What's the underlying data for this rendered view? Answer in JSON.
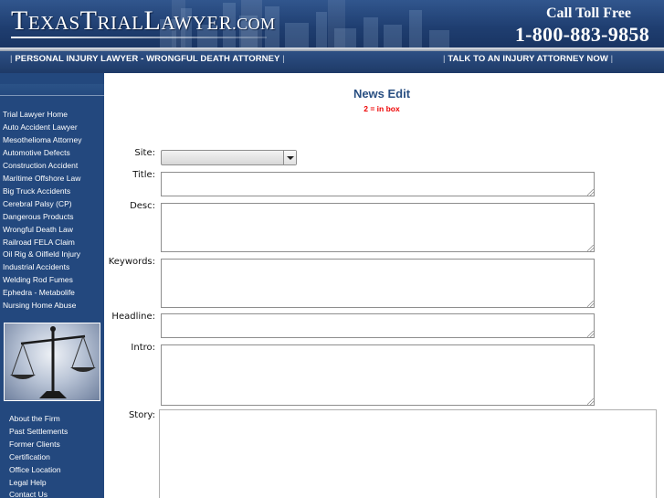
{
  "header": {
    "logo_text": "TexasTrialLawyer.com",
    "logo_parts": [
      "T",
      "EXAS",
      "T",
      "RIAL",
      "L",
      "AWYER",
      ".COM"
    ],
    "call_label": "Call Toll Free",
    "phone": "1-800-883-9858"
  },
  "nav": {
    "left": "PERSONAL INJURY LAWYER - WRONGFUL DEATH ATTORNEY",
    "right": "TALK TO AN INJURY ATTORNEY NOW",
    "separator": "|"
  },
  "sidebar": {
    "practice_links": [
      "Trial Lawyer Home",
      "Auto Accident Lawyer",
      "Mesothelioma Attorney",
      "Automotive Defects",
      "Construction Accident",
      "Maritime Offshore Law",
      "Big Truck Accidents",
      "Cerebral Palsy (CP)",
      "Dangerous Products",
      "Wrongful Death Law",
      "Railroad FELA Claim",
      "Oil Rig & Oilfield Injury",
      "Industrial Accidents",
      "Welding Rod Fumes",
      "Ephedra - Metabolife",
      "Nursing Home Abuse"
    ],
    "firm_links": [
      "About the Firm",
      "Past Settlements",
      "Former Clients",
      "Certification",
      "Office Location",
      "Legal Help",
      "Contact Us"
    ]
  },
  "form": {
    "title": "News Edit",
    "subtitle": "2 = in box",
    "site_label": "Site:",
    "site_value": "",
    "title_label": "Title:",
    "desc_label": "Desc:",
    "keywords_label": "Keywords:",
    "headline_label": "Headline:",
    "intro_label": "Intro:",
    "story_label": "Story:"
  },
  "colors": {
    "header_blue": "#1f3e70",
    "sidebar_blue": "#23487e",
    "title_blue": "#294f82",
    "alert_red": "#ee0000"
  }
}
